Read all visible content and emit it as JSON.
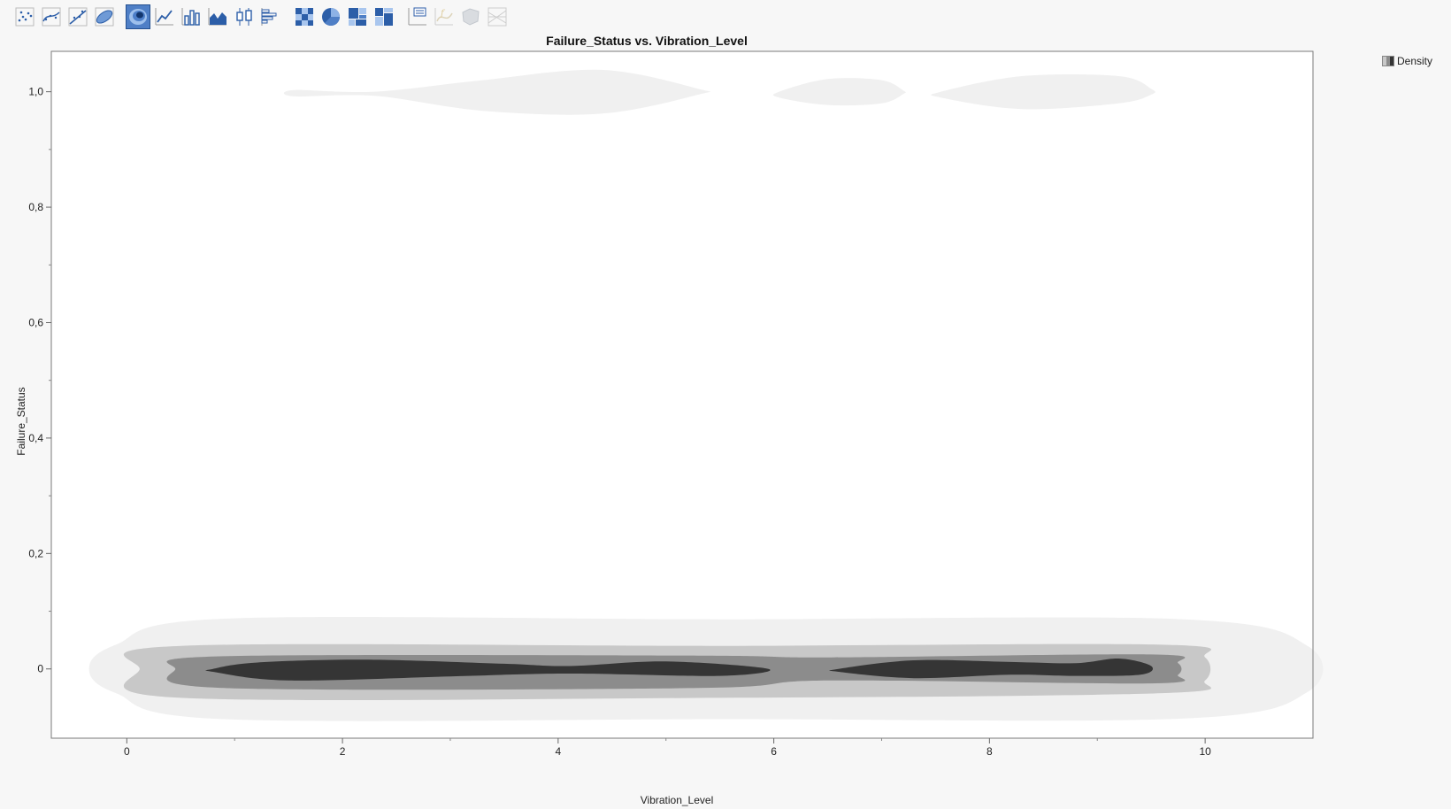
{
  "toolbar": {
    "buttons": [
      {
        "name": "points-element-icon",
        "state": "normal"
      },
      {
        "name": "smoother-element-icon",
        "state": "normal"
      },
      {
        "name": "line-of-fit-element-icon",
        "state": "normal"
      },
      {
        "name": "ellipse-element-icon",
        "state": "normal"
      },
      {
        "name": "contour-element-icon",
        "state": "active"
      },
      {
        "name": "line-element-icon",
        "state": "normal"
      },
      {
        "name": "bar-element-icon",
        "state": "normal"
      },
      {
        "name": "area-element-icon",
        "state": "normal"
      },
      {
        "name": "box-plot-element-icon",
        "state": "normal"
      },
      {
        "name": "histogram-element-icon",
        "state": "normal"
      },
      {
        "name": "heatmap-element-icon",
        "state": "normal"
      },
      {
        "name": "pie-element-icon",
        "state": "normal"
      },
      {
        "name": "treemap-element-icon",
        "state": "normal"
      },
      {
        "name": "mosaic-element-icon",
        "state": "normal"
      },
      {
        "name": "caption-box-element-icon",
        "state": "normal"
      },
      {
        "name": "formula-element-icon",
        "state": "disabled"
      },
      {
        "name": "map-shapes-element-icon",
        "state": "disabled"
      },
      {
        "name": "parallel-element-icon",
        "state": "disabled"
      }
    ],
    "accent_color": "#4f7fc6"
  },
  "chart_data": {
    "type": "contour",
    "title": "Failure_Status vs. Vibration_Level",
    "xlabel": "Vibration_Level",
    "ylabel": "Failure_Status",
    "xlim": [
      -0.7,
      11.0
    ],
    "ylim": [
      -0.12,
      1.07
    ],
    "x_ticks": [
      0,
      2,
      4,
      6,
      8,
      10
    ],
    "x_tick_labels": [
      "0",
      "2",
      "4",
      "6",
      "8",
      "10"
    ],
    "y_ticks": [
      0,
      0.2,
      0.4,
      0.6,
      0.8,
      1.0
    ],
    "y_tick_labels": [
      "0",
      "0,2",
      "0,4",
      "0,6",
      "0,8",
      "1,0"
    ],
    "legend": {
      "label": "Density",
      "position": "top-right"
    },
    "grid": false,
    "levels": [
      {
        "level": 1,
        "color": "#f0f0f0"
      },
      {
        "level": 2,
        "color": "#c8c8c8"
      },
      {
        "level": 3,
        "color": "#8c8c8c"
      },
      {
        "level": 4,
        "color": "#353535"
      }
    ],
    "regions": [
      {
        "level": 1,
        "y": 1,
        "points": [
          [
            1.55,
            1.003
          ],
          [
            2.3,
            1.0
          ],
          [
            3.3,
            1.02
          ],
          [
            4.4,
            1.038
          ],
          [
            5.3,
            1.005
          ],
          [
            5.3,
            0.995
          ],
          [
            4.4,
            0.962
          ],
          [
            3.3,
            0.967
          ],
          [
            2.3,
            0.993
          ],
          [
            1.55,
            0.992
          ]
        ]
      },
      {
        "level": 1,
        "y": 1,
        "points": [
          [
            6.05,
            1.0
          ],
          [
            6.5,
            1.022
          ],
          [
            7.0,
            1.02
          ],
          [
            7.2,
            1.002
          ],
          [
            7.2,
            0.996
          ],
          [
            7.0,
            0.98
          ],
          [
            6.5,
            0.977
          ],
          [
            6.05,
            0.99
          ]
        ]
      },
      {
        "level": 1,
        "y": 1,
        "points": [
          [
            7.55,
            1.0
          ],
          [
            8.3,
            1.027
          ],
          [
            9.2,
            1.027
          ],
          [
            9.5,
            1.005
          ],
          [
            9.5,
            0.995
          ],
          [
            9.2,
            0.98
          ],
          [
            8.3,
            0.97
          ],
          [
            7.55,
            0.99
          ]
        ]
      },
      {
        "level": 1,
        "y": 0,
        "points": [
          [
            -0.35,
            0.0
          ],
          [
            -0.1,
            0.042
          ],
          [
            0.9,
            0.087
          ],
          [
            5.5,
            0.086
          ],
          [
            9.8,
            0.086
          ],
          [
            10.95,
            0.04
          ],
          [
            10.95,
            -0.04
          ],
          [
            9.8,
            -0.086
          ],
          [
            5.5,
            -0.087
          ],
          [
            0.9,
            -0.087
          ],
          [
            -0.1,
            -0.042
          ]
        ]
      },
      {
        "level": 2,
        "y": 0,
        "points": [
          [
            0.12,
            0.0
          ],
          [
            0.5,
            0.04
          ],
          [
            5.5,
            0.04
          ],
          [
            9.6,
            0.042
          ],
          [
            10.0,
            0.02
          ],
          [
            10.0,
            -0.02
          ],
          [
            9.6,
            -0.042
          ],
          [
            5.5,
            -0.05
          ],
          [
            0.5,
            -0.05
          ]
        ]
      },
      {
        "level": 3,
        "y": 0,
        "points": [
          [
            0.45,
            0.0
          ],
          [
            0.9,
            0.022
          ],
          [
            5.3,
            0.023
          ],
          [
            6.5,
            0.02
          ],
          [
            9.5,
            0.025
          ],
          [
            9.75,
            0.01
          ],
          [
            9.75,
            -0.01
          ],
          [
            9.5,
            -0.025
          ],
          [
            6.5,
            -0.02
          ],
          [
            5.3,
            -0.033
          ],
          [
            0.9,
            -0.033
          ]
        ]
      },
      {
        "level": 4,
        "y": 0,
        "points": [
          [
            0.8,
            0.0
          ],
          [
            1.2,
            0.011
          ],
          [
            2.2,
            0.016
          ],
          [
            3.5,
            0.009
          ],
          [
            4.1,
            0.005
          ],
          [
            5.0,
            0.013
          ],
          [
            5.95,
            0.0
          ],
          [
            5.5,
            -0.012
          ],
          [
            4.1,
            -0.008
          ],
          [
            3.0,
            -0.013
          ],
          [
            1.5,
            -0.02
          ],
          [
            0.8,
            -0.005
          ]
        ]
      },
      {
        "level": 4,
        "y": 0,
        "points": [
          [
            6.6,
            0.0
          ],
          [
            7.3,
            0.015
          ],
          [
            8.2,
            0.012
          ],
          [
            8.8,
            0.01
          ],
          [
            9.2,
            0.018
          ],
          [
            9.5,
            0.005
          ],
          [
            9.4,
            -0.01
          ],
          [
            8.8,
            -0.012
          ],
          [
            8.2,
            -0.01
          ],
          [
            7.3,
            -0.016
          ],
          [
            6.6,
            -0.005
          ]
        ]
      }
    ]
  }
}
